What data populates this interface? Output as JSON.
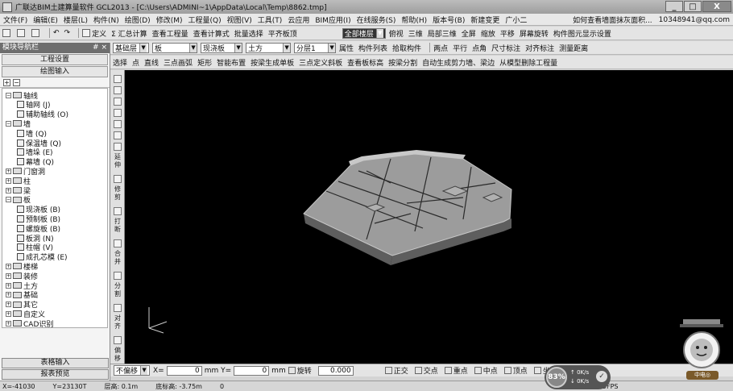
{
  "window": {
    "title": "广联达BIM土建算量软件 GCL2013 - [C:\\Users\\ADMINI~1\\AppData\\Local\\Temp\\8862.tmp]",
    "minimize": "_",
    "maximize": "□",
    "close": "X"
  },
  "menu": {
    "items": [
      "文件(F)",
      "编辑(E)",
      "楼层(L)",
      "构件(N)",
      "绘图(D)",
      "修改(M)",
      "工程量(Q)",
      "视图(V)",
      "工具(T)",
      "云应用",
      "BIM应用(I)",
      "在线服务(S)",
      "帮助(H)",
      "版本号(B)",
      "新建变更",
      "广小二"
    ],
    "hint": "如何查看墙面抹灰面积...",
    "account": "10348941@qq.com"
  },
  "toolbar1": {
    "items": [
      "定义",
      "Σ 汇总计算",
      "查看工程量",
      "查看计算式",
      "批量选择",
      "平齐板顶"
    ],
    "view_combo": "全部楼层",
    "right_items": [
      "俯视",
      "三维",
      "局部三维",
      "全屏",
      "缩放",
      "平移",
      "屏幕旋转",
      "构件图元显示设置"
    ]
  },
  "toolbar2": {
    "floor": "基础层",
    "category": "板",
    "type": "现浇板",
    "material": "土方",
    "layer": "分层1",
    "items": [
      "属性",
      "构件列表",
      "拾取构件",
      "两点",
      "平行",
      "点角",
      "三点辅轴",
      "删除辅轴",
      "尺寸标注",
      "对齐标注",
      "测量距离"
    ]
  },
  "toolbar3": {
    "items": [
      "选择",
      "点",
      "直线",
      "三点画弧",
      "矩形",
      "智能布置",
      "按梁生成单板",
      "三点定义斜板",
      "查看板标高",
      "按梁分割",
      "自动生成剪力墙、梁边"
    ],
    "right_item": "从模型删除工程量"
  },
  "left_panel": {
    "title": "模块导航栏",
    "pin": "# ×",
    "btn_project": "工程设置",
    "btn_draw": "绘图输入",
    "tree": [
      {
        "label": "轴线",
        "level": 0,
        "expanded": true
      },
      {
        "label": "轴网 (J)",
        "level": 1
      },
      {
        "label": "辅助轴线 (O)",
        "level": 1
      },
      {
        "label": "墙",
        "level": 0,
        "expanded": true
      },
      {
        "label": "墙 (Q)",
        "level": 1
      },
      {
        "label": "保温墙 (Q)",
        "level": 1
      },
      {
        "label": "墙垛 (E)",
        "level": 1
      },
      {
        "label": "幕墙 (Q)",
        "level": 1
      },
      {
        "label": "门窗洞",
        "level": 0
      },
      {
        "label": "柱",
        "level": 0
      },
      {
        "label": "梁",
        "level": 0
      },
      {
        "label": "板",
        "level": 0,
        "expanded": true
      },
      {
        "label": "现浇板 (B)",
        "level": 1
      },
      {
        "label": "预制板 (B)",
        "level": 1
      },
      {
        "label": "螺旋板 (B)",
        "level": 1
      },
      {
        "label": "板洞 (N)",
        "level": 1
      },
      {
        "label": "柱帽 (V)",
        "level": 1
      },
      {
        "label": "成孔芯模 (E)",
        "level": 1
      },
      {
        "label": "楼梯",
        "level": 0
      },
      {
        "label": "装修",
        "level": 0
      },
      {
        "label": "土方",
        "level": 0
      },
      {
        "label": "基础",
        "level": 0
      },
      {
        "label": "其它",
        "level": 0
      },
      {
        "label": "自定义",
        "level": 0
      },
      {
        "label": "CAD识别",
        "level": 0
      }
    ],
    "btn_sheet": "表格输入",
    "btn_report": "报表预览"
  },
  "vertical_toolbar": [
    "延伸",
    "修剪",
    "打断",
    "合并",
    "分割",
    "对齐",
    "偏移"
  ],
  "coord_bar": {
    "no_offset": "不偏移",
    "x_label": "X=",
    "x_value": "0",
    "unit1": "mm Y=",
    "y_value": "0",
    "unit2": "mm",
    "rotate_label": "旋转",
    "rotate_value": "0.000",
    "snaps": [
      "正交",
      "交点",
      "重点",
      "中点",
      "顶点",
      "坐标"
    ]
  },
  "performance": {
    "percent": "83%",
    "up": "0K/s",
    "down": "0K/s"
  },
  "status": {
    "x": "X=-41030",
    "y": "Y=23130T",
    "floor_height": "层高: 0.1m",
    "elev": "底标高: -3.75m",
    "count": "0",
    "fps": "193.9FPS"
  },
  "mascot_label": "中电◎",
  "model_colors": {
    "top": "#9c9c9c",
    "side": "#5e5e5e",
    "edge": "#c8c8c8",
    "line": "#2a2a2a"
  }
}
